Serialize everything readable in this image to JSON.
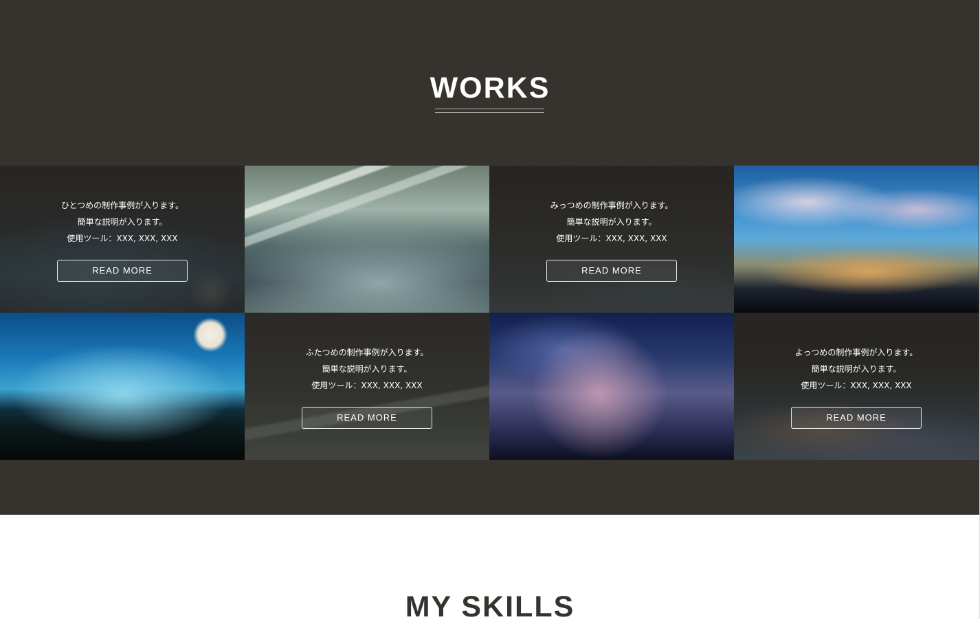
{
  "works": {
    "title": "WORKS",
    "tiles": [
      {
        "kind": "caption",
        "lines": [
          "ひとつめの制作事例が入ります。",
          "簡単な説明が入ります。",
          "使用ツール：XXX, XXX, XXX"
        ],
        "button": "READ MORE"
      },
      {
        "kind": "image",
        "description_icon": "city-reflection-photo"
      },
      {
        "kind": "caption",
        "lines": [
          "みっつめの制作事例が入ります。",
          "簡単な説明が入ります。",
          "使用ツール：XXX, XXX, XXX"
        ],
        "button": "READ MORE"
      },
      {
        "kind": "image",
        "description_icon": "sunset-flowers-photo"
      },
      {
        "kind": "image",
        "description_icon": "night-trees-moon-photo"
      },
      {
        "kind": "caption",
        "lines": [
          "ふたつめの制作事例が入ります。",
          "簡単な説明が入ります。",
          "使用ツール：XXX, XXX, XXX"
        ],
        "button": "READ MORE"
      },
      {
        "kind": "image",
        "description_icon": "starry-water-duck-photo"
      },
      {
        "kind": "caption",
        "lines": [
          "よっつめの制作事例が入ります。",
          "簡単な説明が入ります。",
          "使用ツール：XXX, XXX, XXX"
        ],
        "button": "READ MORE"
      }
    ]
  },
  "skills": {
    "title": "MY SKILLS"
  },
  "colors": {
    "section_bg": "#36332f",
    "text_light": "#ffffff",
    "text_dark": "#36332f"
  }
}
